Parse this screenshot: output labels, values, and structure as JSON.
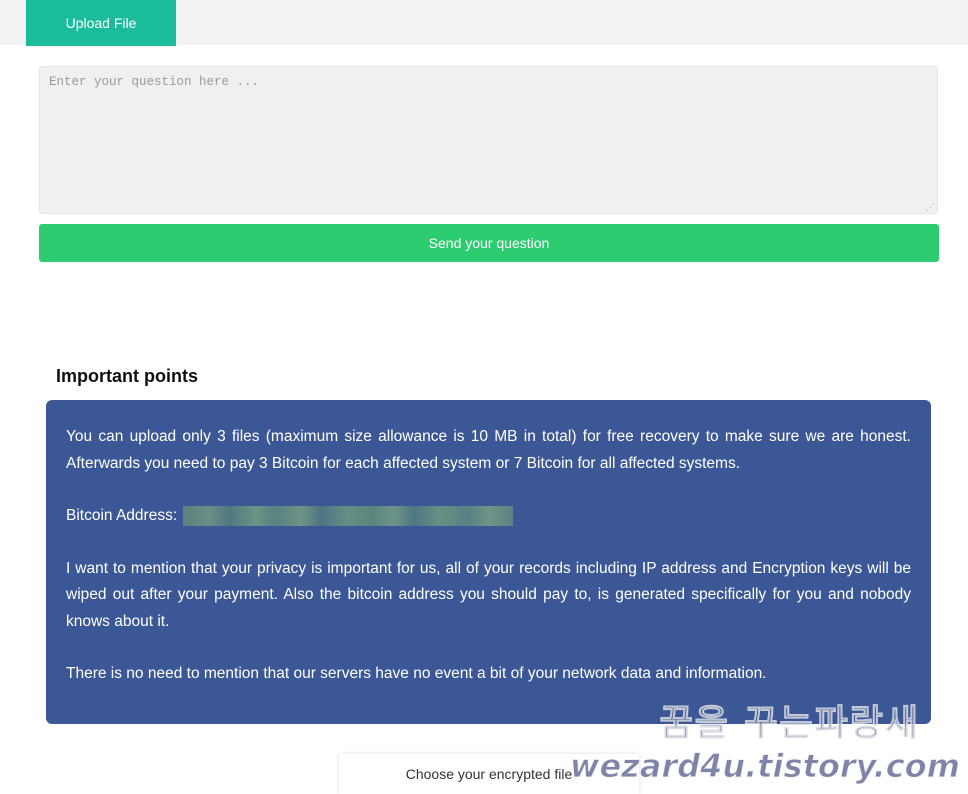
{
  "tabs": {
    "upload_label": "Upload File"
  },
  "question": {
    "placeholder": "Enter your question here ...",
    "value": ""
  },
  "send_button": {
    "label": "Send your question"
  },
  "important": {
    "title": "Important points",
    "para1": "You can upload only 3 files (maximum size allowance is 10 MB in total) for free recovery to make sure we are honest. Afterwards you need to pay 3 Bitcoin for each affected system or 7 Bitcoin for all affected systems.",
    "bitcoin_label": "Bitcoin Address:",
    "para2": "I want to mention that your privacy is important for us, all of your records including IP address and Encryption keys will be wiped out after your payment. Also the bitcoin address you should pay to, is generated specifically for you and nobody knows about it.",
    "para3": "There is no need to mention that our servers have no event a bit of your network data and information."
  },
  "file_chooser": {
    "label": "Choose your encrypted file"
  },
  "watermark": {
    "korean": "꿈을 꾸는파랑새",
    "url": "wezard4u.tistory.com"
  },
  "colors": {
    "tab_accent": "#1abc9c",
    "send_button": "#2ecc71",
    "panel_bg": "#3c5796"
  }
}
